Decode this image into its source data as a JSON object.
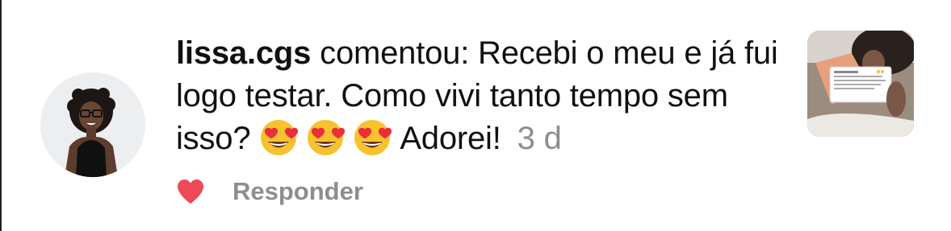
{
  "comment": {
    "username": "lissa.cgs",
    "action_text": "comentou:",
    "body_text": "Recebi o meu e já fui logo testar. Como vivi tanto tempo sem isso?",
    "emojis": [
      "heart-eyes-emoji",
      "heart-eyes-emoji",
      "heart-eyes-emoji"
    ],
    "trailing_text": "Adorei!",
    "timestamp": "3 d"
  },
  "actions": {
    "like_icon": "heart-icon",
    "like_color": "#ed4956",
    "reply_label": "Responder"
  },
  "colors": {
    "text": "#111111",
    "muted": "#8e8e8e",
    "background": "#ffffff"
  }
}
